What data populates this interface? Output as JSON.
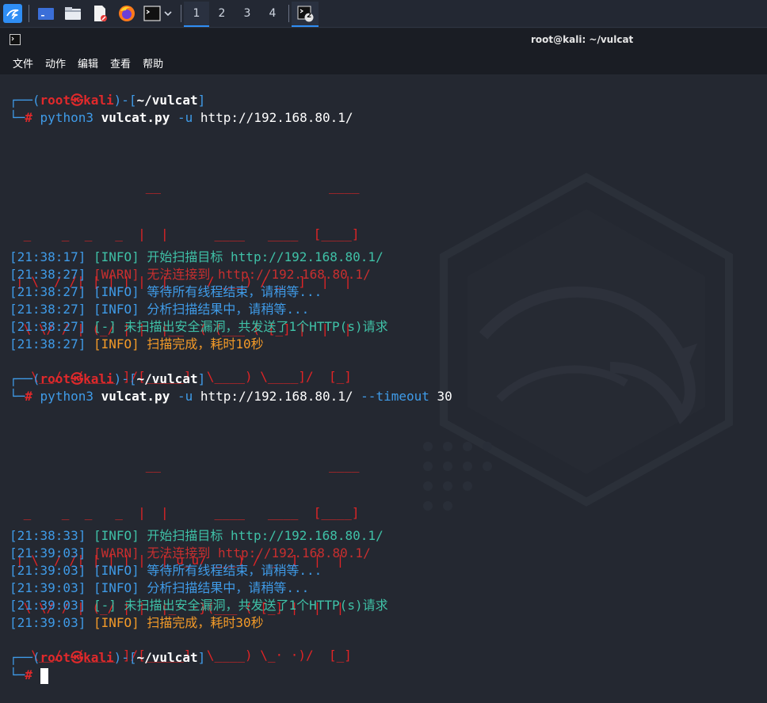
{
  "taskbar": {
    "workspaces": [
      "1",
      "2",
      "3",
      "4"
    ],
    "terminal_task_badge": "2"
  },
  "window": {
    "title": "root@kali: ~/vulcat",
    "menu": [
      "文件",
      "动作",
      "编辑",
      "查看",
      "帮助"
    ]
  },
  "prompt": {
    "user": "root",
    "at": "㉿",
    "host": "kali",
    "path": "~/vulcat"
  },
  "commands": [
    {
      "cmd": "python3",
      "script": "vulcat.py",
      "flag": "-u",
      "url": "http://192.168.80.1/",
      "extra_flag": "",
      "extra_val": ""
    },
    {
      "cmd": "python3",
      "script": "vulcat.py",
      "flag": "-u",
      "url": "http://192.168.80.1/",
      "extra_flag": "--timeout",
      "extra_val": "30"
    }
  ],
  "banner1": [
    "                 __                      ____",
    " _    _  _   _  |  |      ____   ____  [____]",
    "| \\  / /| | | | |  |     / ___) / _  ]  |  |",
    " \\ \\/ / | (_/ | |  |__  ( (___ ( [_] |  |  |",
    "  \\__/  (____ ]/[_____]  \\____) \\____]/  [_]"
  ],
  "banner2": [
    "                 __                      ____",
    " _    _  _   _  |  |      ____   ____  [____]",
    "| \\  / /| | | | |  | u_u/ ___) / _  ]  |  |",
    " \\ \\/ / | (_/ | |  |_· ·}(___ ( [_] |  |  |",
    "  \\__/  (____ ]/[_____]  \\____) \\_· ·)/  [_]"
  ],
  "log1": [
    {
      "time": "[21:38:17]",
      "tag": "[INFO]",
      "msg": "开始扫描目标 http://192.168.80.1/",
      "kind": "info-teal"
    },
    {
      "time": "[21:38:27]",
      "tag": "[WARN]",
      "msg": "无法连接到 http://192.168.80.1/",
      "kind": "warn"
    },
    {
      "time": "[21:38:27]",
      "tag": "[INFO]",
      "msg": "等待所有线程结束，请稍等...",
      "kind": "info-blue"
    },
    {
      "time": "[21:38:27]",
      "tag": "[INFO]",
      "msg": "分析扫描结果中，请稍等...",
      "kind": "info-blue"
    },
    {
      "time": "[21:38:27]",
      "tag": "[-]",
      "msg": "未扫描出安全漏洞，共发送了1个HTTP(s)请求",
      "kind": "result"
    },
    {
      "time": "[21:38:27]",
      "tag": "[INFO]",
      "msg": "扫描完成，耗时10秒",
      "kind": "done"
    }
  ],
  "log2": [
    {
      "time": "[21:38:33]",
      "tag": "[INFO]",
      "msg": "开始扫描目标 http://192.168.80.1/",
      "kind": "info-teal"
    },
    {
      "time": "[21:39:03]",
      "tag": "[WARN]",
      "msg": "无法连接到 http://192.168.80.1/",
      "kind": "warn"
    },
    {
      "time": "[21:39:03]",
      "tag": "[INFO]",
      "msg": "等待所有线程结束，请稍等...",
      "kind": "info-blue"
    },
    {
      "time": "[21:39:03]",
      "tag": "[INFO]",
      "msg": "分析扫描结果中，请稍等...",
      "kind": "info-blue"
    },
    {
      "time": "[21:39:03]",
      "tag": "[-]",
      "msg": "未扫描出安全漏洞，共发送了1个HTTP(s)请求",
      "kind": "result"
    },
    {
      "time": "[21:39:03]",
      "tag": "[INFO]",
      "msg": "扫描完成，耗时30秒",
      "kind": "done"
    }
  ],
  "colors": {
    "prompt_blue": "#3f9be8",
    "prompt_red": "#e0292b",
    "info_teal": "#3fc1a7",
    "warn_red": "#c72f2f",
    "done_orange": "#f39a28",
    "terminal_bg": "#242831"
  }
}
